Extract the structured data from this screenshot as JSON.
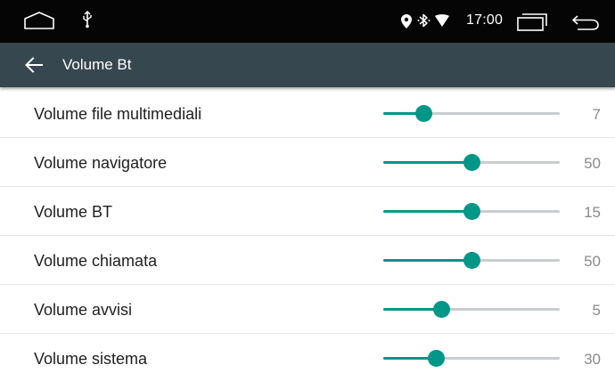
{
  "colors": {
    "status_bar": "#050505",
    "toolbar": "#37474f",
    "accent": "#009688",
    "track": "#c8cdd0"
  },
  "status_bar": {
    "time": "17:00",
    "icons": [
      "home-outline-icon",
      "usb-icon",
      "location-icon",
      "bluetooth-icon",
      "wifi-icon",
      "recents-icon",
      "back-nav-icon"
    ]
  },
  "toolbar": {
    "title": "Volume Bt",
    "back_icon": "arrow-left-icon"
  },
  "settings": [
    {
      "label": "Volume file multimediali",
      "value": "7",
      "level": 0.23
    },
    {
      "label": "Volume navigatore",
      "value": "50",
      "level": 0.5
    },
    {
      "label": "Volume BT",
      "value": "15",
      "level": 0.5
    },
    {
      "label": "Volume chiamata",
      "value": "50",
      "level": 0.5
    },
    {
      "label": "Volume avvisi",
      "value": "5",
      "level": 0.33
    },
    {
      "label": "Volume sistema",
      "value": "30",
      "level": 0.3
    }
  ]
}
